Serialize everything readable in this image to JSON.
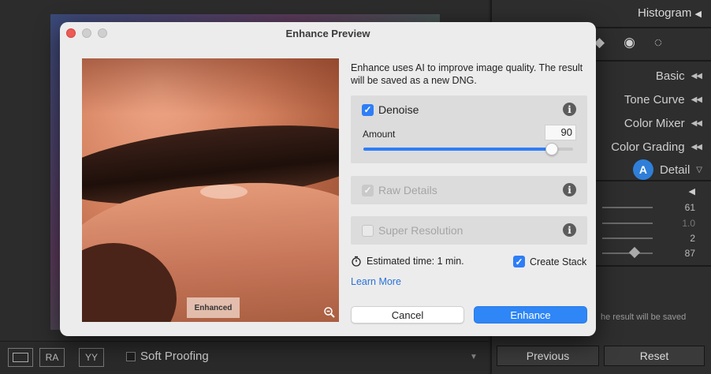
{
  "dialog": {
    "title": "Enhance Preview",
    "description": "Enhance uses AI to improve image quality. The result will be saved as a new DNG.",
    "preview_label": "Enhanced",
    "denoise": {
      "label": "Denoise",
      "checked": true,
      "amount_label": "Amount",
      "amount_value": "90",
      "amount_fraction": 0.9
    },
    "raw_details": {
      "label": "Raw Details",
      "checked": true,
      "disabled": true
    },
    "super_resolution": {
      "label": "Super Resolution",
      "checked": false,
      "disabled": true
    },
    "estimated_time": "Estimated time: 1 min.",
    "create_stack": {
      "label": "Create Stack",
      "checked": true
    },
    "learn_more": "Learn More",
    "cancel_label": "Cancel",
    "enhance_label": "Enhance"
  },
  "right_panel": {
    "histogram": "Histogram",
    "basic": "Basic",
    "tone_curve": "Tone Curve",
    "color_mixer": "Color Mixer",
    "color_grading": "Color Grading",
    "detail": "Detail",
    "badge": "A",
    "detail_values": [
      "61",
      "1.0",
      "2",
      "87"
    ],
    "saved_text": "he result will be saved",
    "previous_label": "Previous",
    "reset_label": "Reset"
  },
  "bottom_bar": {
    "soft_proofing": "Soft Proofing",
    "ra_label": "RA",
    "yy_label": "YY"
  },
  "colors": {
    "accent": "#2e7ef6",
    "badge": "#2f7fd8"
  },
  "icons": [
    "checkmark-icon",
    "info-icon",
    "timer-icon",
    "zoom-out-icon",
    "eraser-icon",
    "eye-icon",
    "circle-dotted-icon"
  ]
}
